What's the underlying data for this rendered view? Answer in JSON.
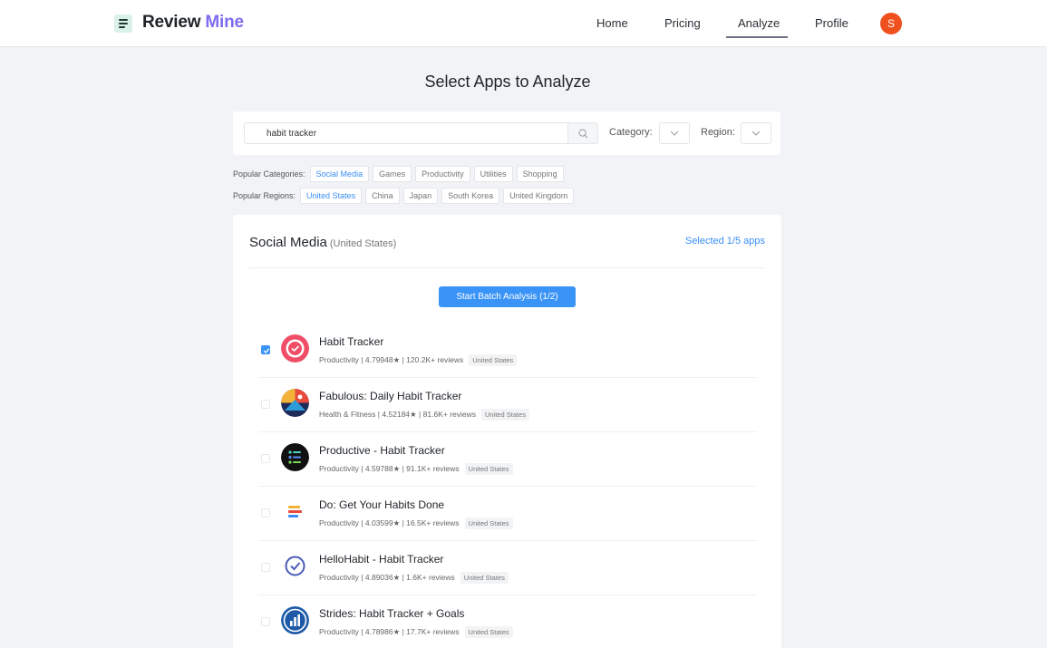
{
  "header": {
    "brand_bold": "Review",
    "brand_accent": "Mine",
    "nav": [
      "Home",
      "Pricing",
      "Analyze",
      "Profile"
    ],
    "active_nav": "Analyze",
    "avatar_initial": "S"
  },
  "page_title": "Select Apps to Analyze",
  "search": {
    "value": "habit tracker",
    "category_label": "Category:",
    "region_label": "Region:"
  },
  "popular_categories": {
    "label": "Popular Categories:",
    "items": [
      "Social Media",
      "Games",
      "Productivity",
      "Utilities",
      "Shopping"
    ],
    "active": "Social Media"
  },
  "popular_regions": {
    "label": "Popular Regions:",
    "items": [
      "United States",
      "China",
      "Japan",
      "South Korea",
      "United Kingdom"
    ],
    "active": "United States"
  },
  "results": {
    "title": "Social Media",
    "region": "(United States)",
    "selected": "Selected 1/5 apps",
    "batch_button": "Start Batch Analysis (1/2)",
    "apps": [
      {
        "name": "Habit Tracker",
        "category": "Productivity",
        "rating": "4.79948★",
        "reviews": "120.2K+ reviews",
        "region": "United States",
        "checked": true,
        "icon": "habit-tracker-icon"
      },
      {
        "name": "Fabulous: Daily Habit Tracker",
        "category": "Health & Fitness",
        "rating": "4.52184★",
        "reviews": "81.6K+ reviews",
        "region": "United States",
        "checked": false,
        "icon": "fabulous-icon"
      },
      {
        "name": "Productive - Habit Tracker",
        "category": "Productivity",
        "rating": "4.59788★",
        "reviews": "91.1K+ reviews",
        "region": "United States",
        "checked": false,
        "icon": "productive-icon"
      },
      {
        "name": "Do: Get Your Habits Done",
        "category": "Productivity",
        "rating": "4.03599★",
        "reviews": "16.5K+ reviews",
        "region": "United States",
        "checked": false,
        "icon": "do-icon"
      },
      {
        "name": "HelloHabit - Habit Tracker",
        "category": "Productivity",
        "rating": "4.89036★",
        "reviews": "1.6K+ reviews",
        "region": "United States",
        "checked": false,
        "icon": "hellohabit-icon"
      },
      {
        "name": "Strides: Habit Tracker + Goals",
        "category": "Productivity",
        "rating": "4.78986★",
        "reviews": "17.7K+ reviews",
        "region": "United States",
        "checked": false,
        "icon": "strides-icon"
      }
    ]
  },
  "colors": {
    "accent_blue": "#3a93f7",
    "brand_purple": "#7d6bf0",
    "avatar_orange": "#f0501e"
  }
}
